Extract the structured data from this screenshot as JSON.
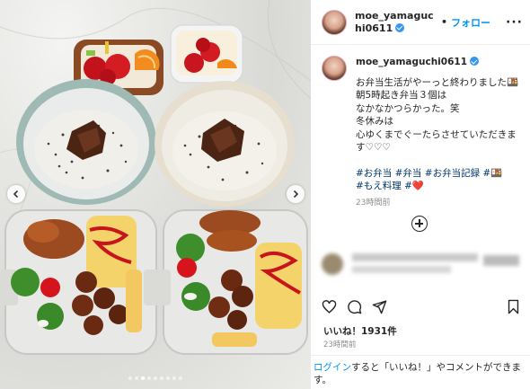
{
  "post": {
    "username": "moe_yamaguchi0611",
    "follow_label": "フォロー",
    "more_label": "···",
    "caption_lines": [
      "お弁当生活がやーっと終わりました🍱",
      "朝5時起き弁当３個は",
      "なかなかつらかった。笑",
      "冬休みは",
      "心ゆくまでぐーたらさせていただきます♡♡♡"
    ],
    "hashtags_line1": "#お弁当 #弁当 #お弁当記録 #🍱",
    "hashtags_line2": "#もえ料理 #❤️",
    "caption_time": "23時間前",
    "likes": "いいね！1931件",
    "post_time": "23時間前",
    "login_link": "ログイン",
    "login_rest": "すると「いいね！」やコメントができます。"
  },
  "icons": {
    "prev": "chevron-left-icon",
    "next": "chevron-right-icon",
    "verified": "verified-badge-icon",
    "add_comment": "plus-circle-icon",
    "like": "heart-icon",
    "comment": "comment-icon",
    "share": "paper-plane-icon",
    "save": "bookmark-icon"
  },
  "carousel": {
    "count": 9,
    "active_index": 2
  },
  "colors": {
    "link": "#0095f6",
    "hashtag": "#00376b",
    "verified": "#3797f0",
    "muted": "#8e8e8e"
  }
}
